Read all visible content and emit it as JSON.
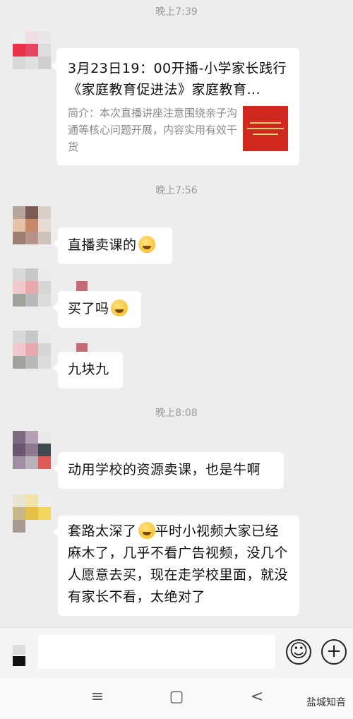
{
  "timestamps": [
    "晚上7:39",
    "晚上7:56",
    "晚上8:08"
  ],
  "link_card": {
    "title": "3月23日19：00开播-小学家长践行《家庭教育促进法》家庭教育...",
    "description": "简介：本次直播讲座注意围绕亲子沟通等核心问题开展，内容实用有效干货"
  },
  "messages": [
    {
      "text": "直播卖课的"
    },
    {
      "text": "买了吗"
    },
    {
      "text": "九块九"
    },
    {
      "text": "动用学校的资源卖课，也是牛啊"
    },
    {
      "text_before": "套路太深了",
      "text_after": "平时小视频大家已经麻木了，几乎不看广告视频，没几个人愿意去买，现在走学校里面，就没有家长不看，太绝对了"
    }
  ],
  "input_bar": {
    "emoji_button": "☺",
    "plus_button": "+"
  },
  "nav_bar": {
    "menu": "≡",
    "home": "▢",
    "back": "<"
  },
  "watermark": "盐城知音",
  "colors": {
    "background": "#ededed",
    "bubble": "#ffffff",
    "timestamp": "#9a9a9a"
  }
}
